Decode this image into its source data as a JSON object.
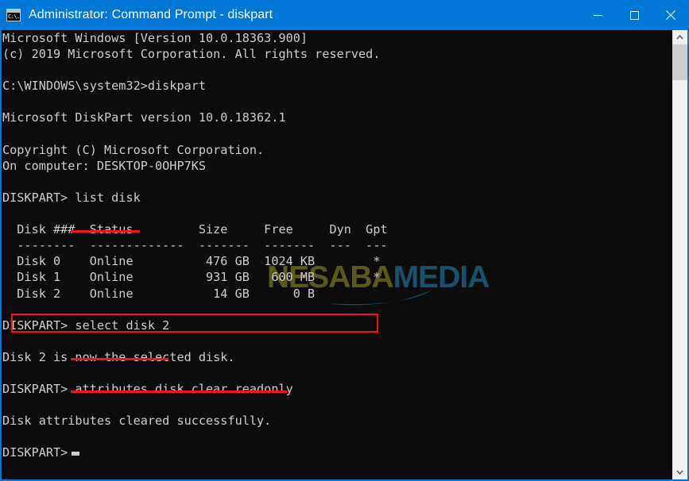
{
  "window": {
    "title": "Administrator: Command Prompt - diskpart",
    "icon_name": "command-prompt-icon",
    "icon_glyph": "C:\\.",
    "accent_color": "#0078d7",
    "terminal_bg": "#0c0c0c",
    "terminal_fg": "#cccccc",
    "annotation_color": "#f41414"
  },
  "controls": {
    "minimize_label": "Minimize",
    "maximize_label": "Maximize",
    "close_label": "Close"
  },
  "terminal": {
    "lines": [
      "Microsoft Windows [Version 10.0.18363.900]",
      "(c) 2019 Microsoft Corporation. All rights reserved.",
      "",
      "C:\\WINDOWS\\system32>diskpart",
      "",
      "Microsoft DiskPart version 10.0.18362.1",
      "",
      "Copyright (C) Microsoft Corporation.",
      "On computer: DESKTOP-0OHP7KS",
      "",
      "DISKPART> list disk",
      "",
      "  Disk ###  Status         Size     Free     Dyn  Gpt",
      "  --------  -------------  -------  -------  ---  ---",
      "  Disk 0    Online          476 GB  1024 KB        *",
      "  Disk 1    Online          931 GB   600 MB        *",
      "  Disk 2    Online           14 GB      0 B",
      "",
      "DISKPART> select disk 2",
      "",
      "Disk 2 is now the selected disk.",
      "",
      "DISKPART> attributes disk clear readonly",
      "",
      "Disk attributes cleared successfully.",
      "",
      "DISKPART> "
    ],
    "prompt_label": "DISKPART>",
    "cursor_visible": true
  },
  "disk_table": {
    "headers": [
      "Disk ###",
      "Status",
      "Size",
      "Free",
      "Dyn",
      "Gpt"
    ],
    "rows": [
      {
        "disk": "Disk 0",
        "status": "Online",
        "size": "476 GB",
        "free": "1024 KB",
        "dyn": "",
        "gpt": "*"
      },
      {
        "disk": "Disk 1",
        "status": "Online",
        "size": "931 GB",
        "free": "600 MB",
        "dyn": "",
        "gpt": "*"
      },
      {
        "disk": "Disk 2",
        "status": "Online",
        "size": "14 GB",
        "free": "0 B",
        "dyn": "",
        "gpt": ""
      }
    ],
    "highlighted_row": "Disk 2"
  },
  "commands": {
    "list_disk": "list disk",
    "select_disk": "select disk 2",
    "attributes_clear": "attributes disk clear readonly"
  },
  "messages": {
    "selected": "Disk 2 is now the selected disk.",
    "cleared": "Disk attributes cleared successfully."
  },
  "watermark": {
    "part_one": "NESABA",
    "part_two": "MEDIA",
    "color_one": "#5a5a18",
    "color_two": "#16526b"
  },
  "scrollbar": {
    "up_label": "Scroll up",
    "down_label": "Scroll down",
    "thumb_label": "Scroll thumb"
  }
}
